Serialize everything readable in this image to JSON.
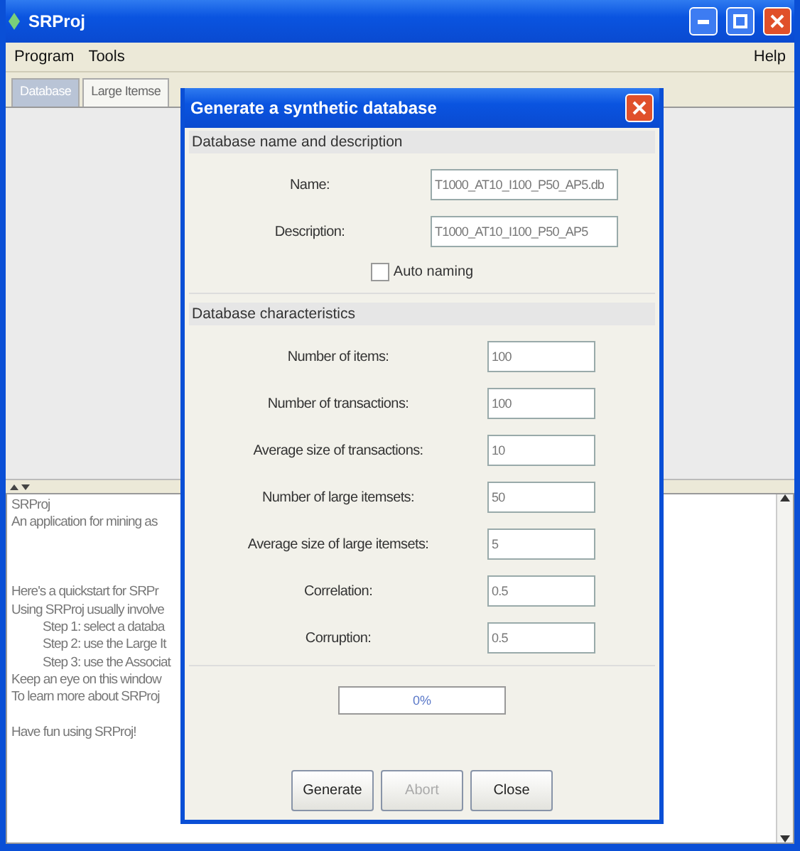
{
  "window": {
    "title": "SRProj"
  },
  "menus": [
    {
      "label": "Program"
    },
    {
      "label": "Tools"
    }
  ],
  "help_menu": {
    "label": "Help"
  },
  "tabs": [
    {
      "label": "Database",
      "selected": true
    },
    {
      "label": "Large Itemse",
      "selected": false
    }
  ],
  "log": [
    {
      "kind": "plain",
      "text": "SRProj"
    },
    {
      "kind": "plain",
      "text": "An application for mining as"
    },
    {
      "kind": "blank"
    },
    {
      "kind": "blank"
    },
    {
      "kind": "blank"
    },
    {
      "kind": "plain",
      "text": "Here's a quickstart for SRPr"
    },
    {
      "kind": "plain",
      "text": "Using SRProj usually involve"
    },
    {
      "kind": "step",
      "text": "Step 1: select a databa"
    },
    {
      "kind": "step",
      "text": "Step 2: use the Large It"
    },
    {
      "kind": "step",
      "text": "Step 3: use the Associat"
    },
    {
      "kind": "plain",
      "text": "Keep an eye on this window"
    },
    {
      "kind": "plain",
      "text": "To learn more about SRProj"
    },
    {
      "kind": "blank"
    },
    {
      "kind": "plain",
      "text": "Have fun using SRProj!"
    }
  ],
  "dialog": {
    "title": "Generate a synthetic database",
    "sections": [
      {
        "kind": "text",
        "title": "Database name and description",
        "fields": [
          {
            "label": "Name:",
            "value": "T1000_AT10_I100_P50_AP5.db"
          },
          {
            "label": "Description:",
            "value": "T1000_AT10_I100_P50_AP5"
          }
        ],
        "checkbox": {
          "label": "Auto naming",
          "checked": false
        }
      },
      {
        "kind": "number",
        "title": "Database characteristics",
        "fields": [
          {
            "label": "Number of items:",
            "value": "100"
          },
          {
            "label": "Number of transactions:",
            "value": "100"
          },
          {
            "label": "Average size of transactions:",
            "value": "10"
          },
          {
            "label": "Number of large itemsets:",
            "value": "50"
          },
          {
            "label": "Average size of large itemsets:",
            "value": "5"
          },
          {
            "label": "Correlation:",
            "value": "0.5"
          },
          {
            "label": "Corruption:",
            "value": "0.5"
          }
        ]
      }
    ],
    "progress": {
      "level": 0,
      "reading": "0%"
    },
    "buttons": [
      {
        "label": "Generate",
        "disabled": false
      },
      {
        "label": "Abort",
        "disabled": true
      },
      {
        "label": "Close",
        "disabled": false
      }
    ]
  }
}
